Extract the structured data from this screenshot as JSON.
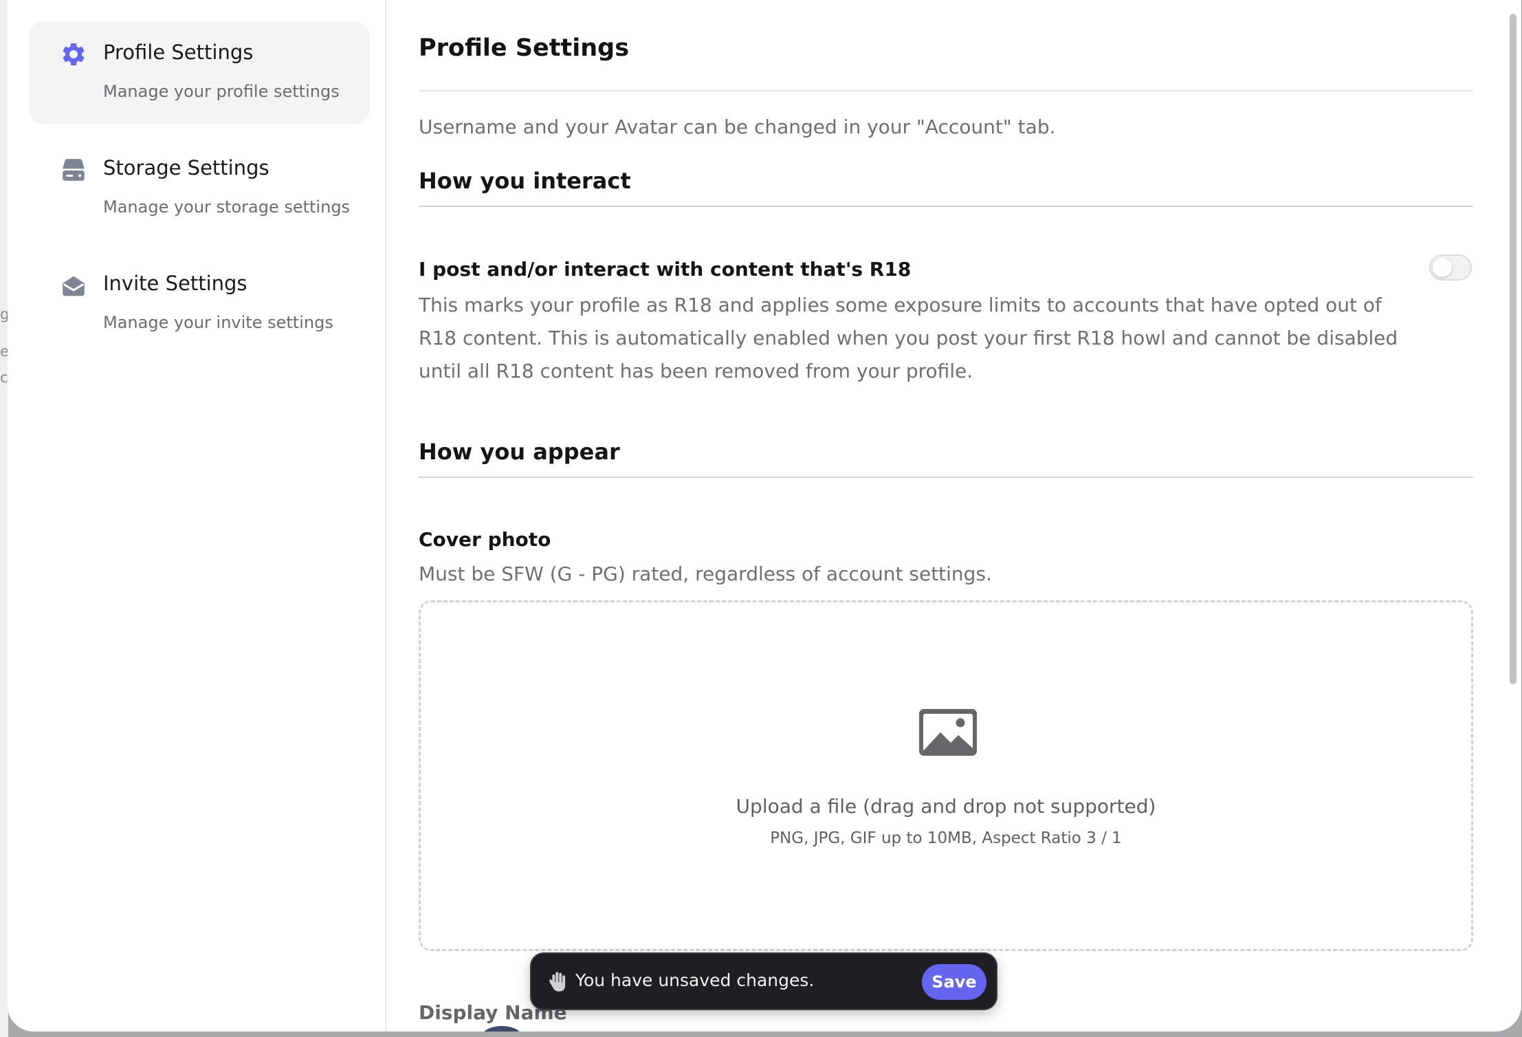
{
  "backdrop": {
    "fragments": [
      "g",
      "e",
      "c"
    ]
  },
  "sidebar": {
    "items": [
      {
        "title": "Profile Settings",
        "subtitle": "Manage your profile settings",
        "icon": "gear-icon",
        "active": true
      },
      {
        "title": "Storage Settings",
        "subtitle": "Manage your storage settings",
        "icon": "hard-drive-icon",
        "active": false
      },
      {
        "title": "Invite Settings",
        "subtitle": "Manage your invite settings",
        "icon": "envelope-open-icon",
        "active": false
      }
    ]
  },
  "main": {
    "title": "Profile Settings",
    "account_note": "Username and your Avatar can be changed in your \"Account\" tab.",
    "interact": {
      "heading": "How you interact",
      "r18_label": "I post and/or interact with content that's R18",
      "r18_description": "This marks your profile as R18 and applies some exposure limits to accounts that have opted out of R18 content. This is automatically enabled when you post your first R18 howl and cannot be disabled until all R18 content has been removed from your profile.",
      "r18_enabled": false
    },
    "appear": {
      "heading": "How you appear",
      "cover_label": "Cover photo",
      "cover_note": "Must be SFW (G - PG) rated, regardless of account settings.",
      "upload_title": "Upload a file (drag and drop not supported)",
      "upload_hint": "PNG, JPG, GIF up to 10MB, Aspect Ratio 3 / 1",
      "display_name_label": "Display Name"
    }
  },
  "toast": {
    "message": "You have unsaved changes.",
    "save_label": "Save",
    "icon": "hand-icon"
  },
  "colors": {
    "accent": "#6466ef",
    "toast_bg": "#1f1f23",
    "active_nav_bg": "#f4f4f5",
    "icon_gray": "#7f8594"
  }
}
